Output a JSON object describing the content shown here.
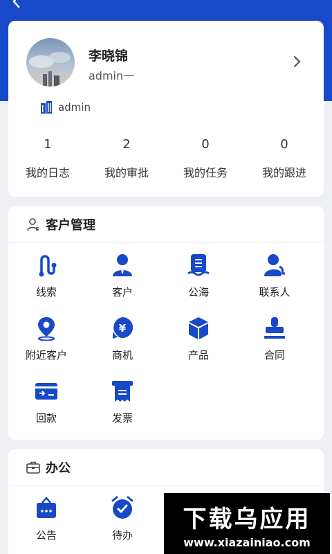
{
  "colors": {
    "brand": "#1749c9",
    "icon": "#1749c9",
    "background": "#eef0f4"
  },
  "profile": {
    "name": "李晓锦",
    "role": "admin一",
    "org": "admin",
    "stats": [
      {
        "value": "1",
        "label": "我的日志"
      },
      {
        "value": "2",
        "label": "我的审批"
      },
      {
        "value": "0",
        "label": "我的任务"
      },
      {
        "value": "0",
        "label": "我的跟进"
      }
    ]
  },
  "customer": {
    "title": "客户管理",
    "items": [
      {
        "label": "线索",
        "icon": "clue-icon"
      },
      {
        "label": "客户",
        "icon": "customer-icon"
      },
      {
        "label": "公海",
        "icon": "public-sea-icon"
      },
      {
        "label": "联系人",
        "icon": "contact-icon"
      },
      {
        "label": "附近客户",
        "icon": "location-pin-icon"
      },
      {
        "label": "商机",
        "icon": "business-opportunity-icon"
      },
      {
        "label": "产品",
        "icon": "product-box-icon"
      },
      {
        "label": "合同",
        "icon": "contract-stamp-icon"
      },
      {
        "label": "回款",
        "icon": "payment-card-icon"
      },
      {
        "label": "发票",
        "icon": "invoice-icon"
      }
    ]
  },
  "office": {
    "title": "办公",
    "items": [
      {
        "label": "公告",
        "icon": "announcement-icon"
      },
      {
        "label": "待办",
        "icon": "todo-clock-icon"
      }
    ]
  },
  "watermark": {
    "title": "下载乌应用",
    "url": "www.xiazainiao.com"
  }
}
